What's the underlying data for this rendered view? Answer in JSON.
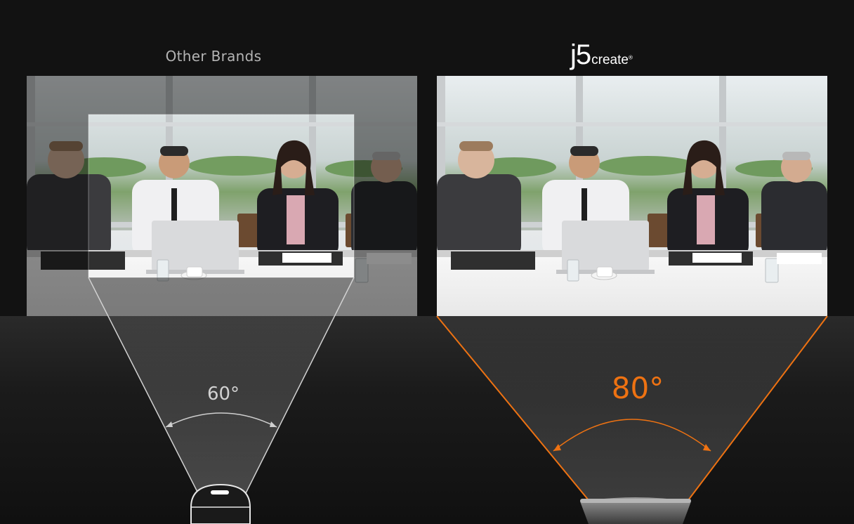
{
  "comparison": {
    "left": {
      "heading": "Other Brands",
      "angle": "60°"
    },
    "right": {
      "brand_mark": "j5",
      "brand_word": "create",
      "brand_reg": "®",
      "angle": "80°"
    }
  },
  "colors": {
    "background": "#121212",
    "accent_orange": "#ee7212",
    "left_lines": "#d2d2d2"
  },
  "icons": {
    "left_device": "dome-camera-icon",
    "right_device": "webcam-icon"
  }
}
